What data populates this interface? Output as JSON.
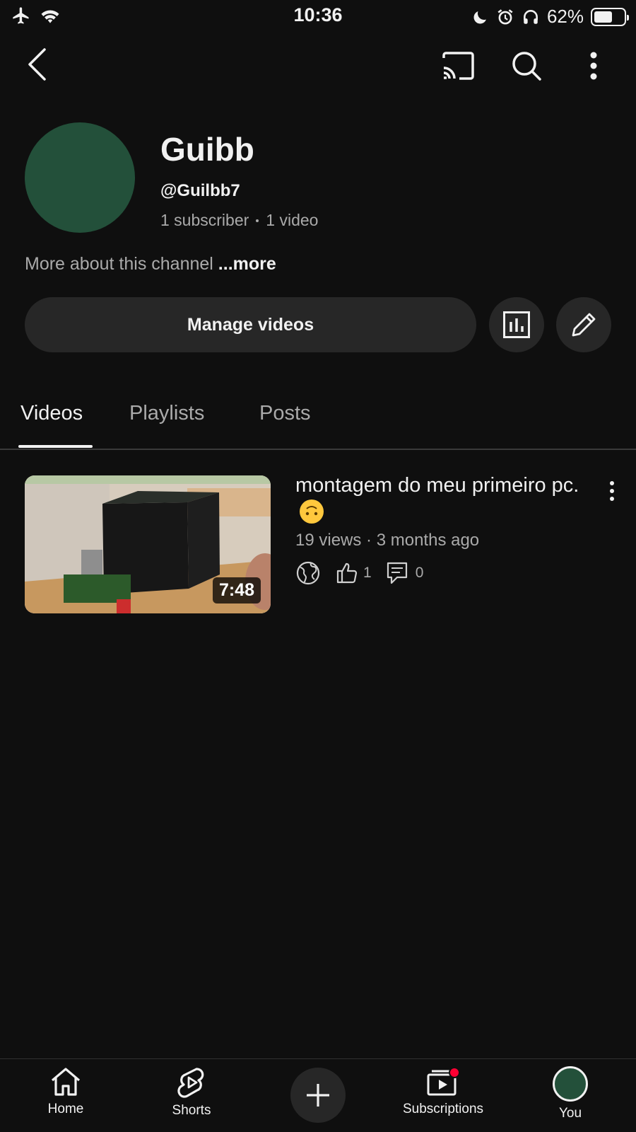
{
  "status_bar": {
    "time": "10:36",
    "battery": "62%",
    "battery_level": 0.62
  },
  "channel": {
    "name": "Guibb",
    "handle": "@Guilbb7",
    "subscribers": "1 subscriber",
    "videos": "1 video",
    "about_text": "More about this channel",
    "more_label": "...more",
    "avatar_color": "#23503a"
  },
  "actions": {
    "manage_videos_label": "Manage videos"
  },
  "tabs": [
    {
      "label": "Videos",
      "active": true
    },
    {
      "label": "Playlists",
      "active": false
    },
    {
      "label": "Posts",
      "active": false
    }
  ],
  "videos": [
    {
      "title": "montagem do meu primeiro pc.",
      "duration": "7:48",
      "views": "19 views",
      "age": "3 months ago",
      "likes": "1",
      "comments": "0"
    }
  ],
  "bottom_nav": [
    {
      "label": "Home",
      "icon": "home-icon"
    },
    {
      "label": "Shorts",
      "icon": "shorts-icon"
    },
    {
      "label": "",
      "icon": "plus-icon"
    },
    {
      "label": "Subscriptions",
      "icon": "subscriptions-icon"
    },
    {
      "label": "You",
      "icon": "avatar"
    }
  ],
  "colors": {
    "background": "#0f0f0f",
    "surface": "#272727",
    "notification": "#ff0033"
  }
}
